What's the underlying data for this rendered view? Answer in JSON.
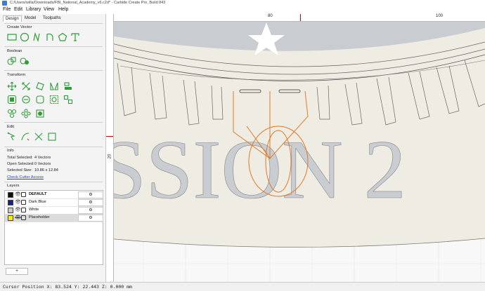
{
  "window": {
    "title": "C:/Users/willa/Downloads/FBI_National_Academy_v6.c2d* - Carbide Create Pro, Build 843"
  },
  "menu": {
    "file": "File",
    "edit": "Edit",
    "library": "Library",
    "view": "View",
    "help": "Help"
  },
  "tabs": {
    "design": "Design",
    "model": "Model",
    "toolpaths": "Toolpaths"
  },
  "sections": {
    "create_vector": "Create Vector",
    "boolean": "Boolean",
    "transform": "Transform",
    "edit": "Edit",
    "info": "Info",
    "layers": "Layers"
  },
  "info": {
    "total_selected_label": "Total Selected:",
    "total_selected": "4 Vectors",
    "open_selected_label": "Open Selected:",
    "open_selected": "0 Vectors",
    "selected_size_label": "Selected Size:",
    "selected_size": "10.86 x 12.84",
    "check_cutter": "Check Cutter Access"
  },
  "layers": [
    {
      "name": "DEFAULT",
      "color": "#111111",
      "bold": true,
      "visible": true
    },
    {
      "name": "Dark Blue",
      "color": "#1a237e",
      "bold": false,
      "visible": true
    },
    {
      "name": "White",
      "color": "#c8c8c8",
      "bold": false,
      "visible": true
    },
    {
      "name": "Placeholder",
      "color": "#f5f000",
      "bold": false,
      "visible": false,
      "selected": true
    }
  ],
  "layer_gear": "⚙",
  "add_layer": "+",
  "rulers": {
    "top_80": "80",
    "top_100": "100",
    "left_20": "20"
  },
  "canvas_text": "SSION 2",
  "colors": {
    "selection": "#e07b26",
    "seal_gray": "#c9ccd1",
    "cream": "#efece3",
    "ruler_marker": "#cc0000"
  },
  "status": "Cursor Position X: 83.524 Y: 22.443 Z: 0.000 mm"
}
